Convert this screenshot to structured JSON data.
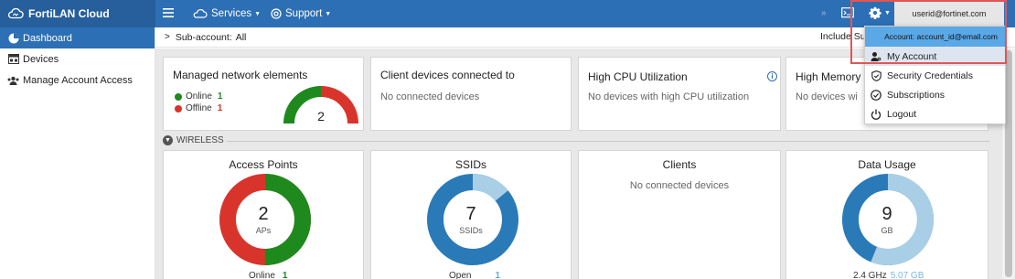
{
  "app": {
    "name": "FortiLAN Cloud"
  },
  "topnav": {
    "services": "Services",
    "support": "Support",
    "user_id": "userid@fortinet.com"
  },
  "sidebar": {
    "items": [
      {
        "label": "Dashboard",
        "icon": "dashboard-icon",
        "active": true
      },
      {
        "label": "Devices",
        "icon": "devices-icon",
        "active": false
      },
      {
        "label": "Manage Account Access",
        "icon": "users-icon",
        "active": false
      }
    ]
  },
  "subbar": {
    "label": "Sub-account:",
    "value": "All",
    "include_text": "Include Su"
  },
  "cards": {
    "managed": {
      "title": "Managed network elements",
      "online_label": "Online",
      "online_count": "1",
      "offline_label": "Offline",
      "offline_count": "1",
      "gauge_value": "2"
    },
    "client_devices": {
      "title": "Client devices connected to",
      "empty": "No connected devices"
    },
    "high_cpu": {
      "title": "High CPU Utilization",
      "empty": "No devices with high CPU utilization"
    },
    "high_memory": {
      "title": "High Memory U",
      "empty": "No devices wi"
    }
  },
  "wireless": {
    "section_label": "WIRELESS",
    "access_points": {
      "title": "Access Points",
      "value": "2",
      "unit": "APs",
      "legend_label": "Online",
      "legend_value": "1",
      "online_fraction": 0.5
    },
    "ssids": {
      "title": "SSIDs",
      "value": "7",
      "unit": "SSIDs",
      "legend_label": "Open",
      "legend_value": "1",
      "open_fraction": 0.14
    },
    "clients": {
      "title": "Clients",
      "empty": "No connected devices"
    },
    "data_usage": {
      "title": "Data Usage",
      "value": "9",
      "unit": "GB",
      "legend_label": "2.4 GHz",
      "legend_value": "5.07 GB",
      "band_24_fraction": 0.56
    }
  },
  "dropdown": {
    "account_line": "Account: account_id@email.com",
    "items": [
      {
        "label": "My Account",
        "icon": "user-key-icon"
      },
      {
        "label": "Security Credentials",
        "icon": "shield-icon"
      },
      {
        "label": "Subscriptions",
        "icon": "check-circle-icon"
      },
      {
        "label": "Logout",
        "icon": "power-icon"
      }
    ]
  },
  "colors": {
    "topbar": "#2d6fb4",
    "brand_bg": "#265f9c",
    "online_green": "#1e8a1e",
    "offline_red": "#d9342b",
    "donut_blue": "#2a7ab8",
    "donut_light_blue": "#a9cfe6",
    "dropdown_header": "#5aa8e6"
  }
}
